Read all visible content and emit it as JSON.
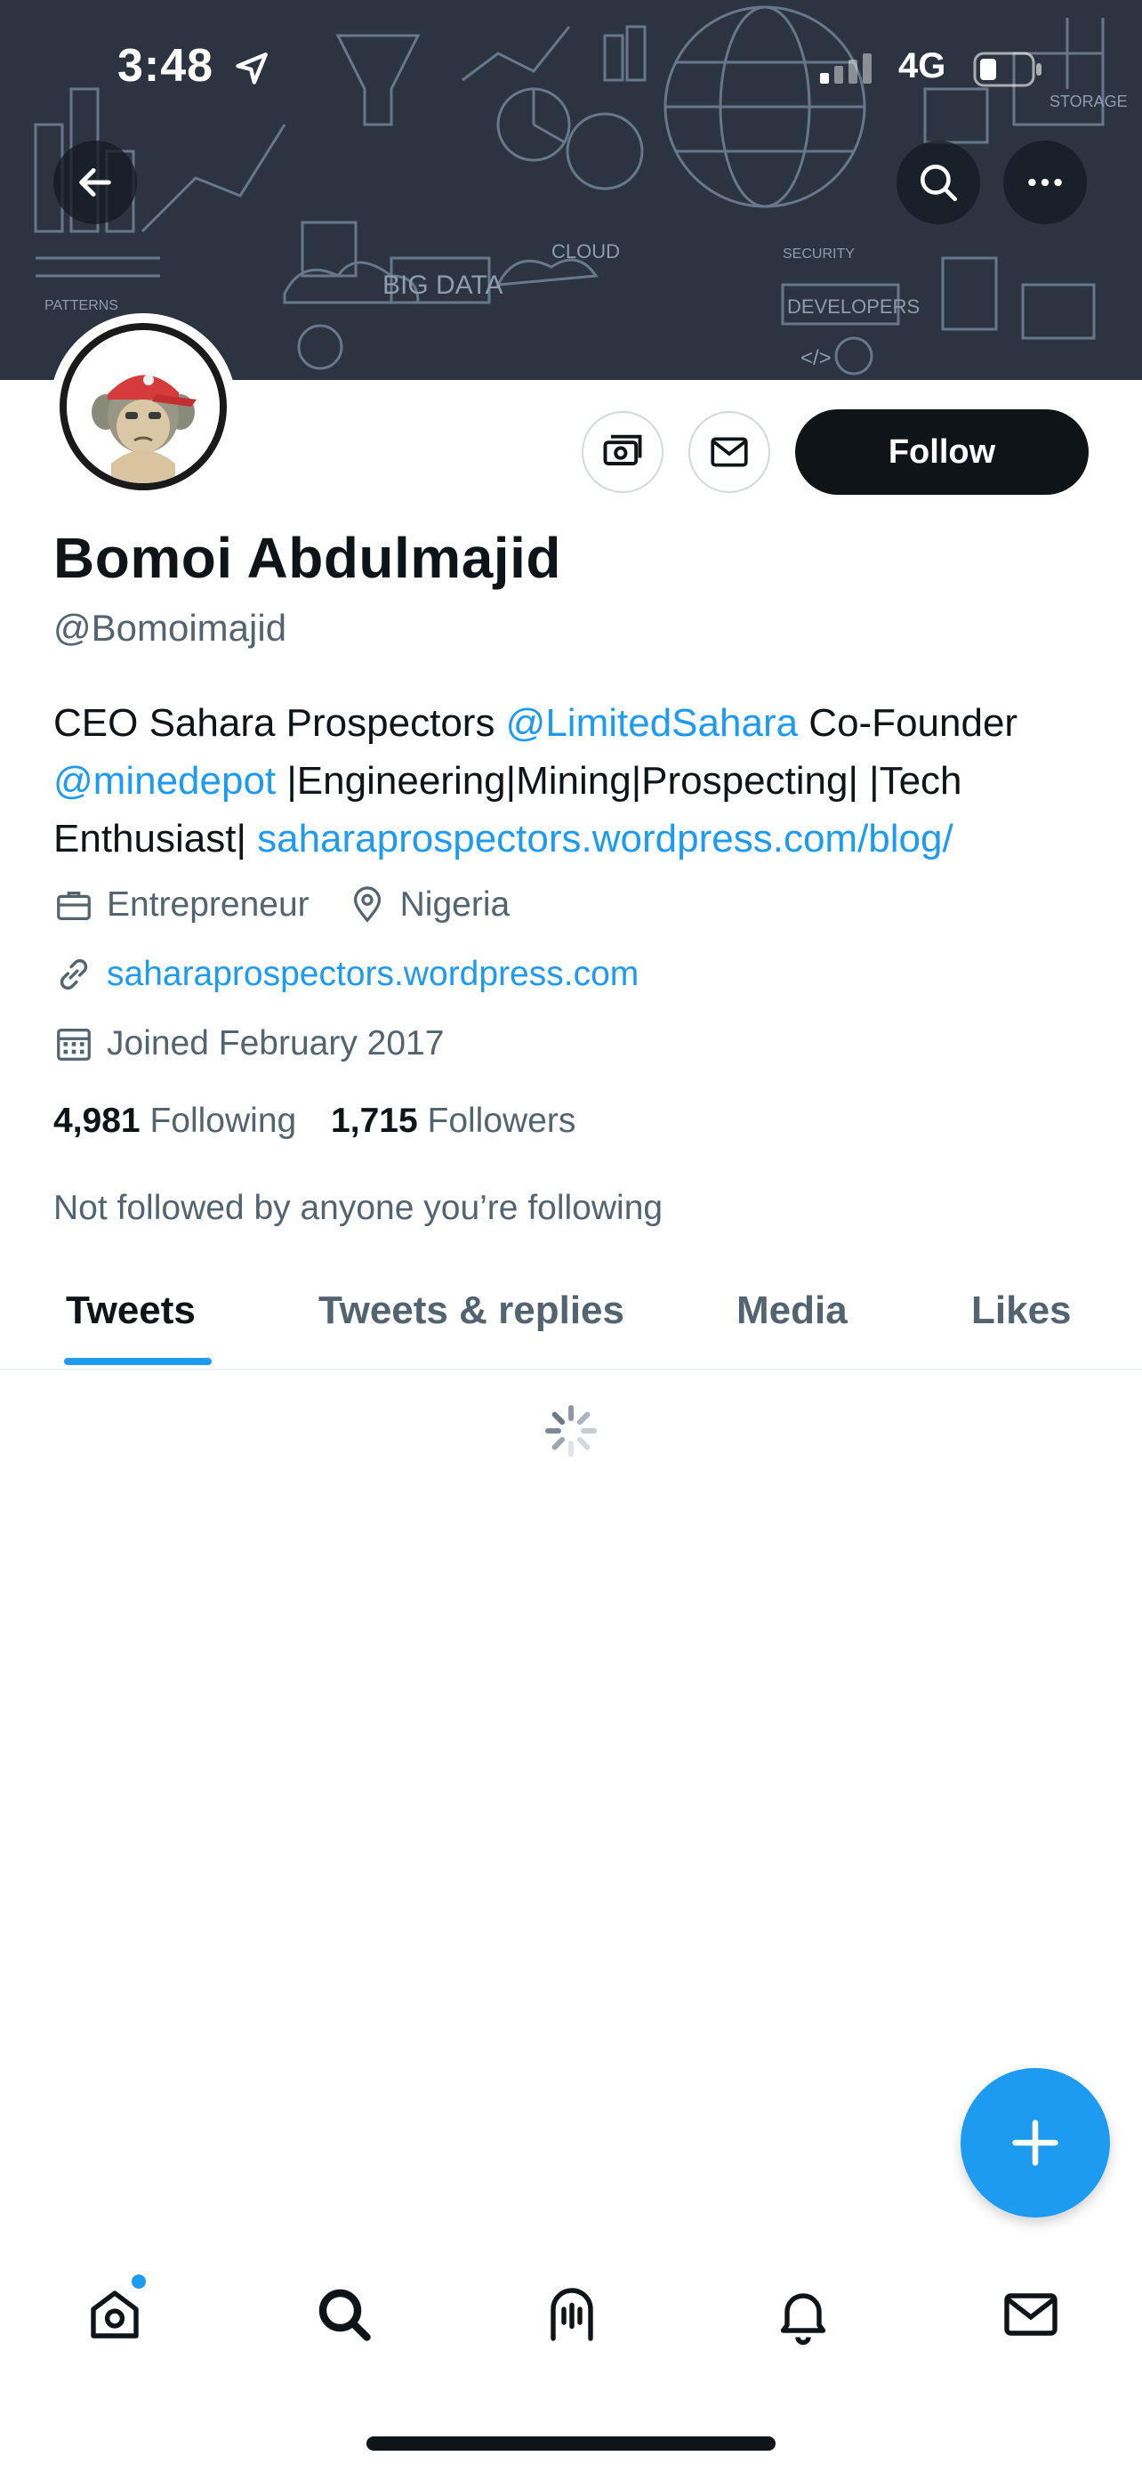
{
  "status_bar": {
    "time": "3:48",
    "network": "4G"
  },
  "banner": {
    "labels": [
      "BIG DATA",
      "CLOUD",
      "DEVELOPERS",
      "STORAGE",
      "SECURITY",
      "PATTERNS",
      "</>"
    ],
    "background_color": "#2b3440"
  },
  "header_actions": {
    "back": "arrow-left-icon",
    "search": "search-icon",
    "more": "more-horizontal-icon"
  },
  "profile": {
    "name": "Bomoi Abdulmajid",
    "handle": "@Bomoimajid",
    "follow_label": "Follow",
    "bio": {
      "part1": "CEO Sahara Prospectors ",
      "mention1": "@LimitedSahara",
      "part2": " Co-Founder ",
      "mention2": "@minedepot",
      "part3": " |Engineering|Mining|Prospecting| |Tech Enthusiast| ",
      "bio_link": "saharaprospectors.wordpress.com/blog/"
    },
    "profession": "Entrepreneur",
    "location": "Nigeria",
    "website": "saharaprospectors.wordpress.com",
    "joined": "Joined February 2017",
    "following_count": "4,981",
    "following_label": "Following",
    "followers_count": "1,715",
    "followers_label": "Followers",
    "not_followed": "Not followed by anyone you’re following"
  },
  "tabs": [
    {
      "label": "Tweets",
      "active": true
    },
    {
      "label": "Tweets & replies",
      "active": false
    },
    {
      "label": "Media",
      "active": false
    },
    {
      "label": "Likes",
      "active": false
    }
  ],
  "bottom_nav": [
    "home-icon",
    "search-icon",
    "spaces-icon",
    "notifications-icon",
    "messages-icon"
  ],
  "colors": {
    "accent": "#1d9bf0",
    "text_primary": "#0f1419",
    "text_secondary": "#536471"
  }
}
